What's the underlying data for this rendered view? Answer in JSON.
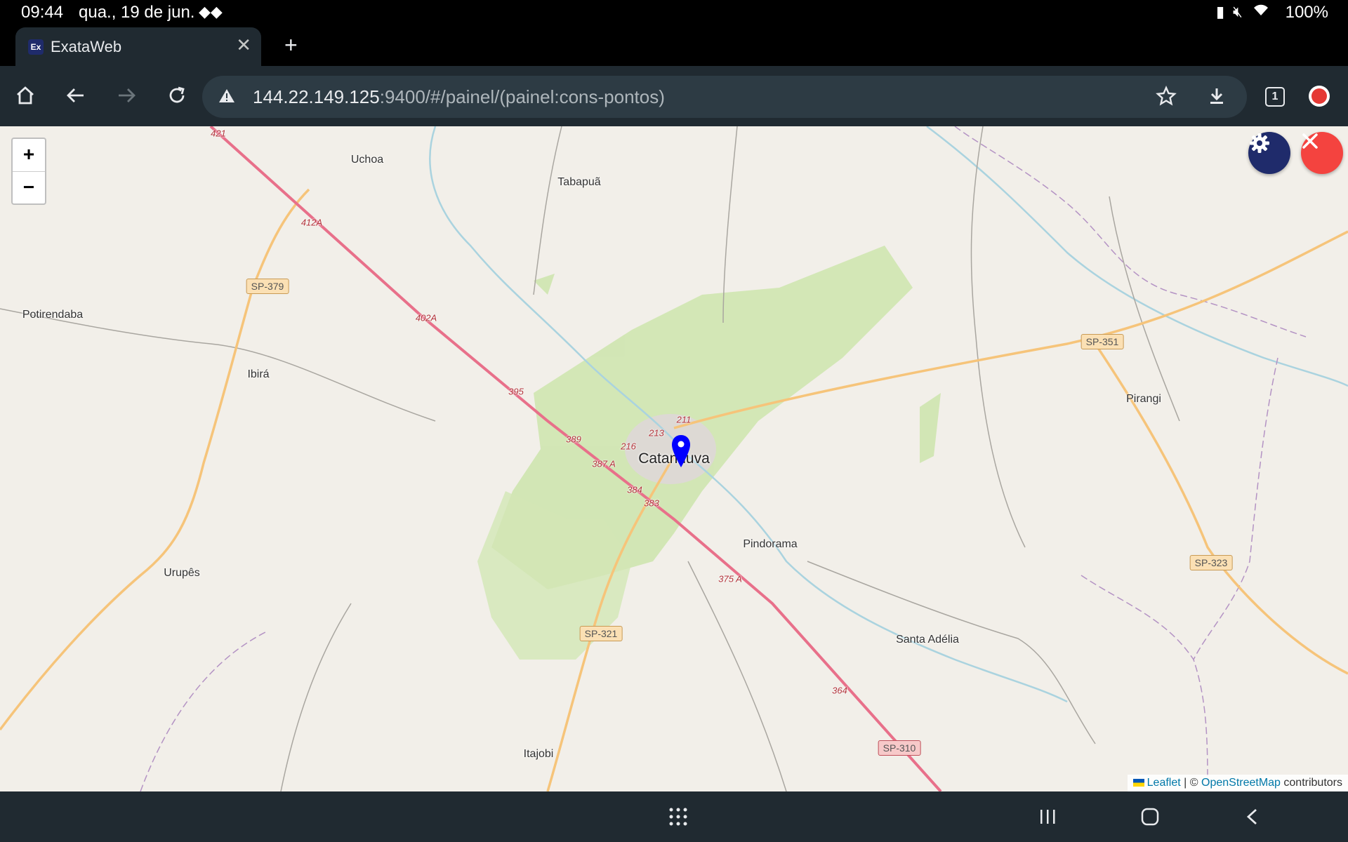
{
  "status_bar": {
    "time": "09:44",
    "date": "qua., 19 de jun.",
    "battery": "100%"
  },
  "tab": {
    "favicon_text": "Ex",
    "title": "ExataWeb",
    "new_tab_icon": "plus-icon",
    "close_icon": "close-icon"
  },
  "toolbar": {
    "url_host": "144.22.149.125",
    "url_rest": ":9400/#/painel/(painel:cons-pontos)",
    "tab_count": "1"
  },
  "map": {
    "zoom_in": "+",
    "zoom_out": "−",
    "places": {
      "catanduva": "Catanduva",
      "uchoa": "Uchoa",
      "tabapua": "Tabapuã",
      "potirendaba": "Potirendaba",
      "ibira": "Ibirá",
      "urupes": "Urupês",
      "pindorama": "Pindorama",
      "pirangi": "Pirangi",
      "santa_adelia": "Santa Adélia",
      "itajobi": "Itajobi"
    },
    "road_shields": {
      "sp379": "SP-379",
      "sp351": "SP-351",
      "sp321": "SP-321",
      "sp323": "SP-323",
      "sp310": "SP-310"
    },
    "km_markers": {
      "k421": "421",
      "k412a": "412A",
      "k402a": "402A",
      "k395": "395",
      "k389": "389",
      "k387a": "387 A",
      "k384": "384",
      "k383": "383",
      "k375a": "375 A",
      "k364": "364",
      "k216": "216",
      "k213": "213",
      "k211": "211"
    },
    "attribution": {
      "leaflet": "Leaflet",
      "sep": "| ©",
      "osm": "OpenStreetMap",
      "contributors": "contributors"
    },
    "marker_color": "#0000ff"
  },
  "colors": {
    "fab_settings": "#1f2b6b",
    "fab_close": "#f4433f",
    "highway": "#e8708a",
    "secondary_road": "#f6c47a"
  }
}
